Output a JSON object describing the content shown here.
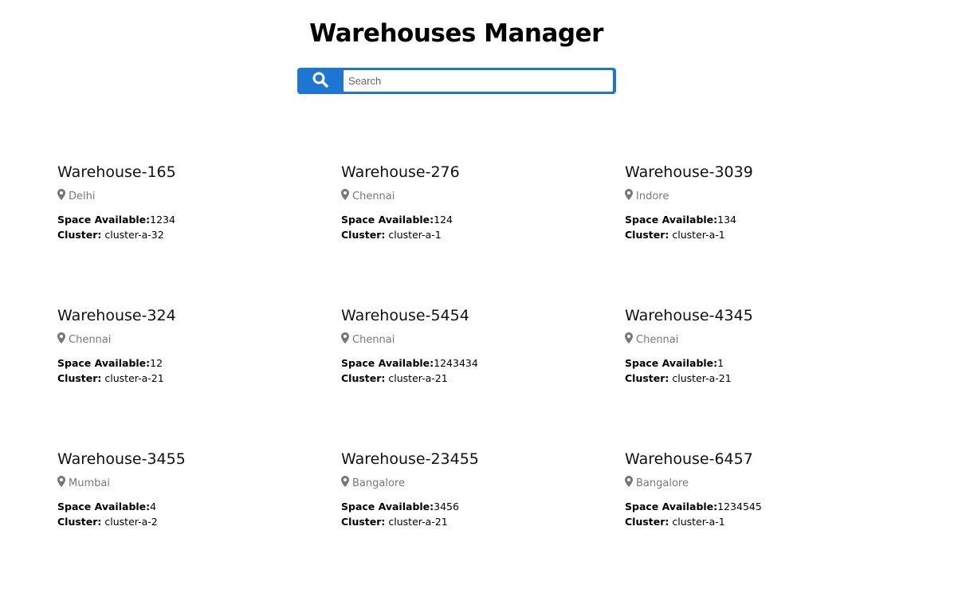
{
  "header": {
    "title": "Warehouses Manager"
  },
  "search": {
    "placeholder": "Search",
    "value": "",
    "icon": "search-icon"
  },
  "labels": {
    "space": "Space Available:",
    "cluster": "Cluster:"
  },
  "colors": {
    "accent": "#1e76d2",
    "location": "#777777"
  },
  "warehouses": [
    {
      "name": "Warehouse-165",
      "city": "Delhi",
      "space": "1234",
      "cluster": "cluster-a-32"
    },
    {
      "name": "Warehouse-276",
      "city": "Chennai",
      "space": "124",
      "cluster": "cluster-a-1"
    },
    {
      "name": "Warehouse-3039",
      "city": "Indore",
      "space": "134",
      "cluster": "cluster-a-1"
    },
    {
      "name": "Warehouse-324",
      "city": "Chennai",
      "space": "12",
      "cluster": "cluster-a-21"
    },
    {
      "name": "Warehouse-5454",
      "city": "Chennai",
      "space": "1243434",
      "cluster": "cluster-a-21"
    },
    {
      "name": "Warehouse-4345",
      "city": "Chennai",
      "space": "1",
      "cluster": "cluster-a-21"
    },
    {
      "name": "Warehouse-3455",
      "city": "Mumbai",
      "space": "4",
      "cluster": "cluster-a-2"
    },
    {
      "name": "Warehouse-23455",
      "city": "Bangalore",
      "space": "3456",
      "cluster": "cluster-a-21"
    },
    {
      "name": "Warehouse-6457",
      "city": "Bangalore",
      "space": "1234545",
      "cluster": "cluster-a-1"
    }
  ]
}
